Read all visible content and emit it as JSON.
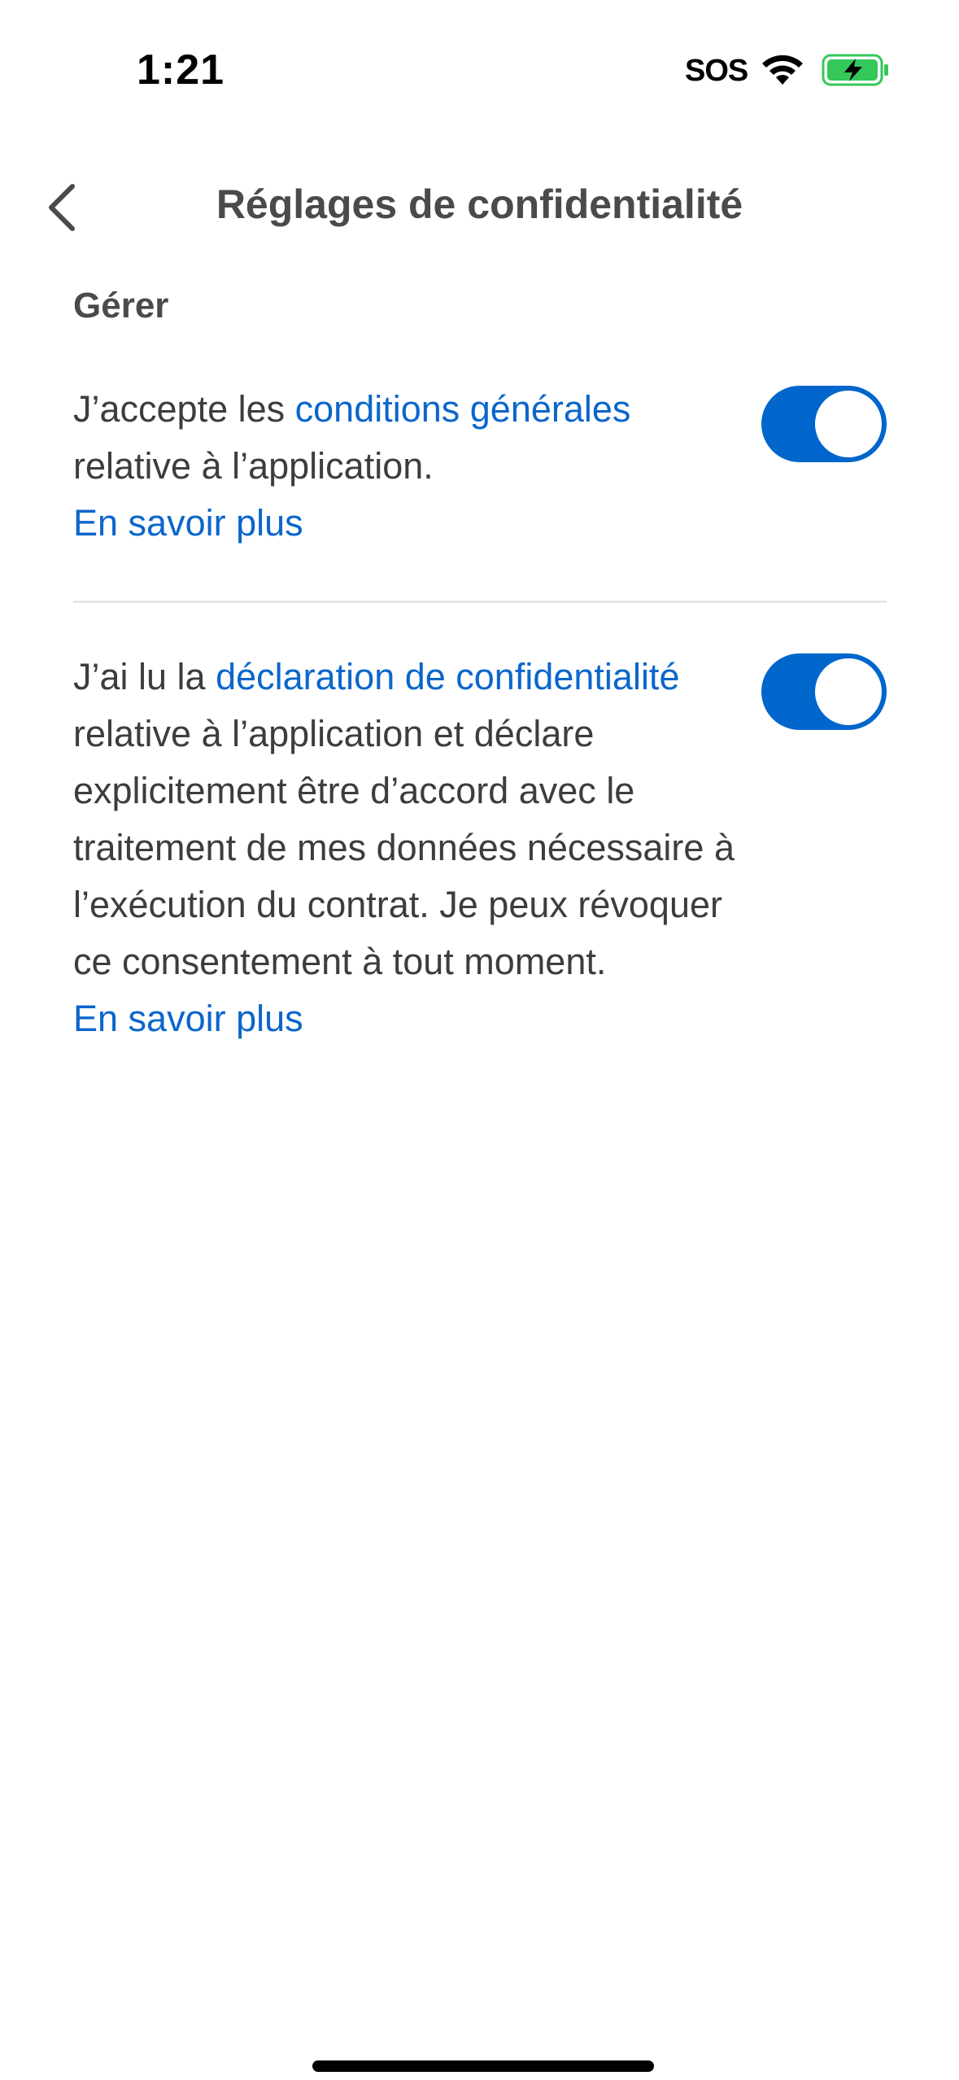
{
  "status_bar": {
    "time": "1:21",
    "sos": "SOS",
    "wifi_icon": "wifi-icon",
    "battery_icon": "battery-charging-icon",
    "battery_color": "#34c759"
  },
  "nav": {
    "back_icon": "chevron-left-icon",
    "title": "Réglages de confidentialité"
  },
  "section": {
    "header": "Gérer"
  },
  "settings": [
    {
      "text_before": "J’accepte les ",
      "link_text": "conditions générales",
      "text_after": " relative à l’application.",
      "learn_more": "En savoir plus",
      "toggle_on": true
    },
    {
      "text_before": "J’ai lu la ",
      "link_text": "déclaration de confidentialité",
      "text_after": " relative à l’application et déclare explicitement être d’accord avec le traitement de mes données nécessaire à l’exécution du contrat. Je peux révoquer ce consentement à tout moment.",
      "learn_more": "En savoir plus",
      "toggle_on": true
    }
  ],
  "colors": {
    "accent": "#0066cc",
    "link": "#0b66cc",
    "text": "#3d3d3d",
    "divider": "#e6e6e6"
  }
}
